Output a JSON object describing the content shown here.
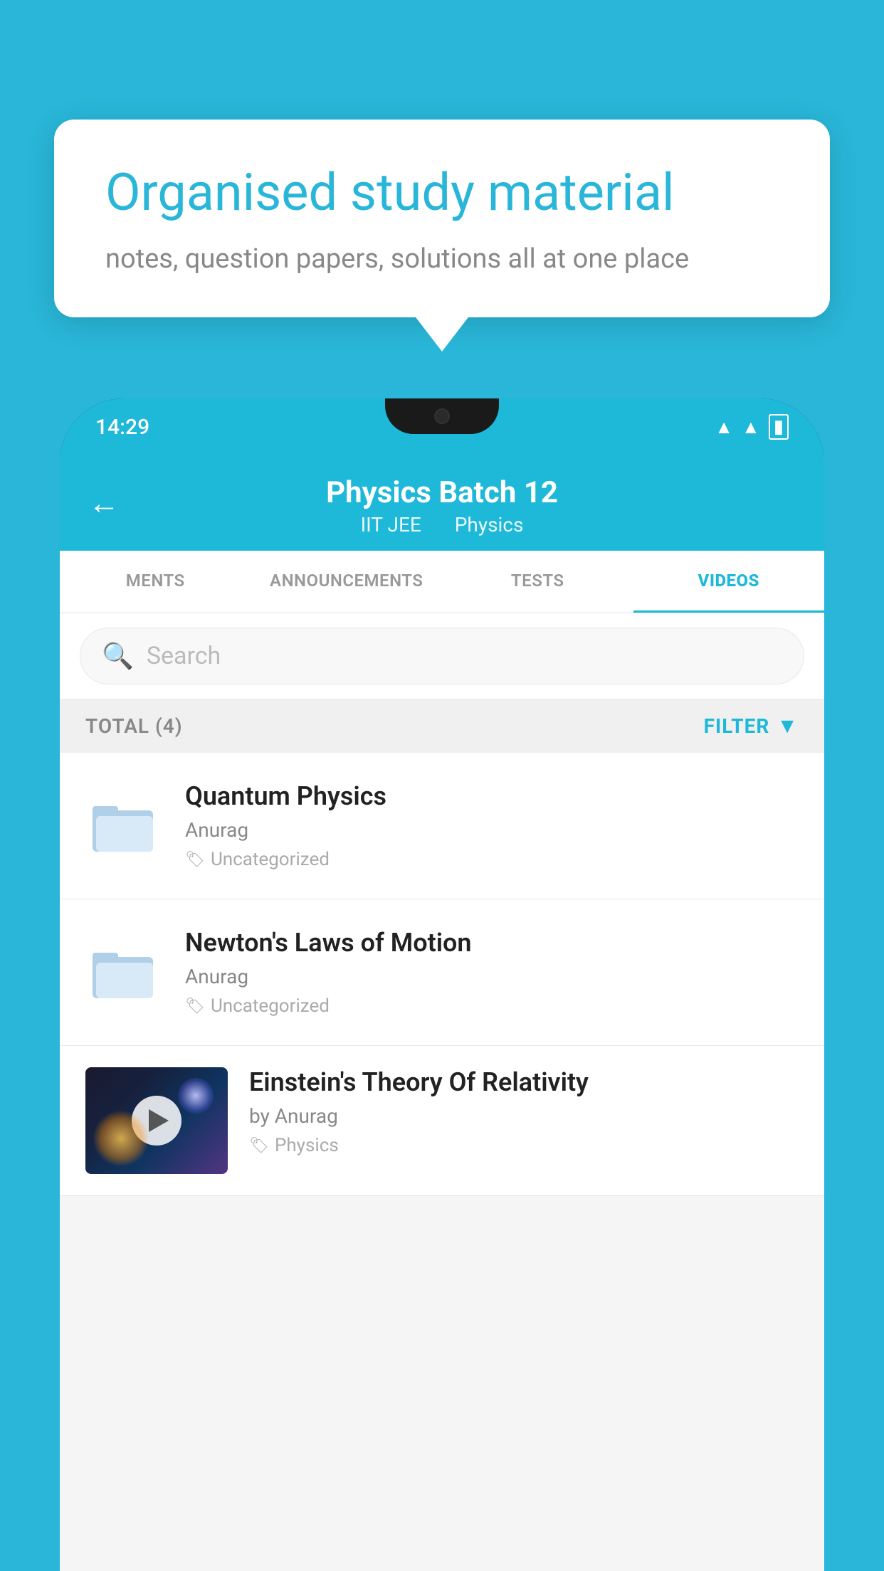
{
  "background_color": "#29b6d8",
  "bubble": {
    "title": "Organised study material",
    "subtitle": "notes, question papers, solutions all at one place"
  },
  "status_bar": {
    "time": "14:29",
    "wifi": "▲",
    "signal": "▲",
    "battery": "▮"
  },
  "header": {
    "back_label": "←",
    "title": "Physics Batch 12",
    "subtitle_part1": "IIT JEE",
    "subtitle_part2": "Physics"
  },
  "tabs": [
    {
      "id": "ments",
      "label": "MENTS",
      "active": false
    },
    {
      "id": "announcements",
      "label": "ANNOUNCEMENTS",
      "active": false
    },
    {
      "id": "tests",
      "label": "TESTS",
      "active": false
    },
    {
      "id": "videos",
      "label": "VIDEOS",
      "active": true
    }
  ],
  "search": {
    "placeholder": "Search"
  },
  "filter_bar": {
    "total_label": "TOTAL (4)",
    "filter_label": "FILTER"
  },
  "videos": [
    {
      "id": 1,
      "title": "Quantum Physics",
      "author": "Anurag",
      "tag": "Uncategorized",
      "type": "folder",
      "has_thumbnail": false
    },
    {
      "id": 2,
      "title": "Newton's Laws of Motion",
      "author": "Anurag",
      "tag": "Uncategorized",
      "type": "folder",
      "has_thumbnail": false
    },
    {
      "id": 3,
      "title": "Einstein's Theory Of Relativity",
      "author": "by Anurag",
      "tag": "Physics",
      "type": "video",
      "has_thumbnail": true
    }
  ]
}
